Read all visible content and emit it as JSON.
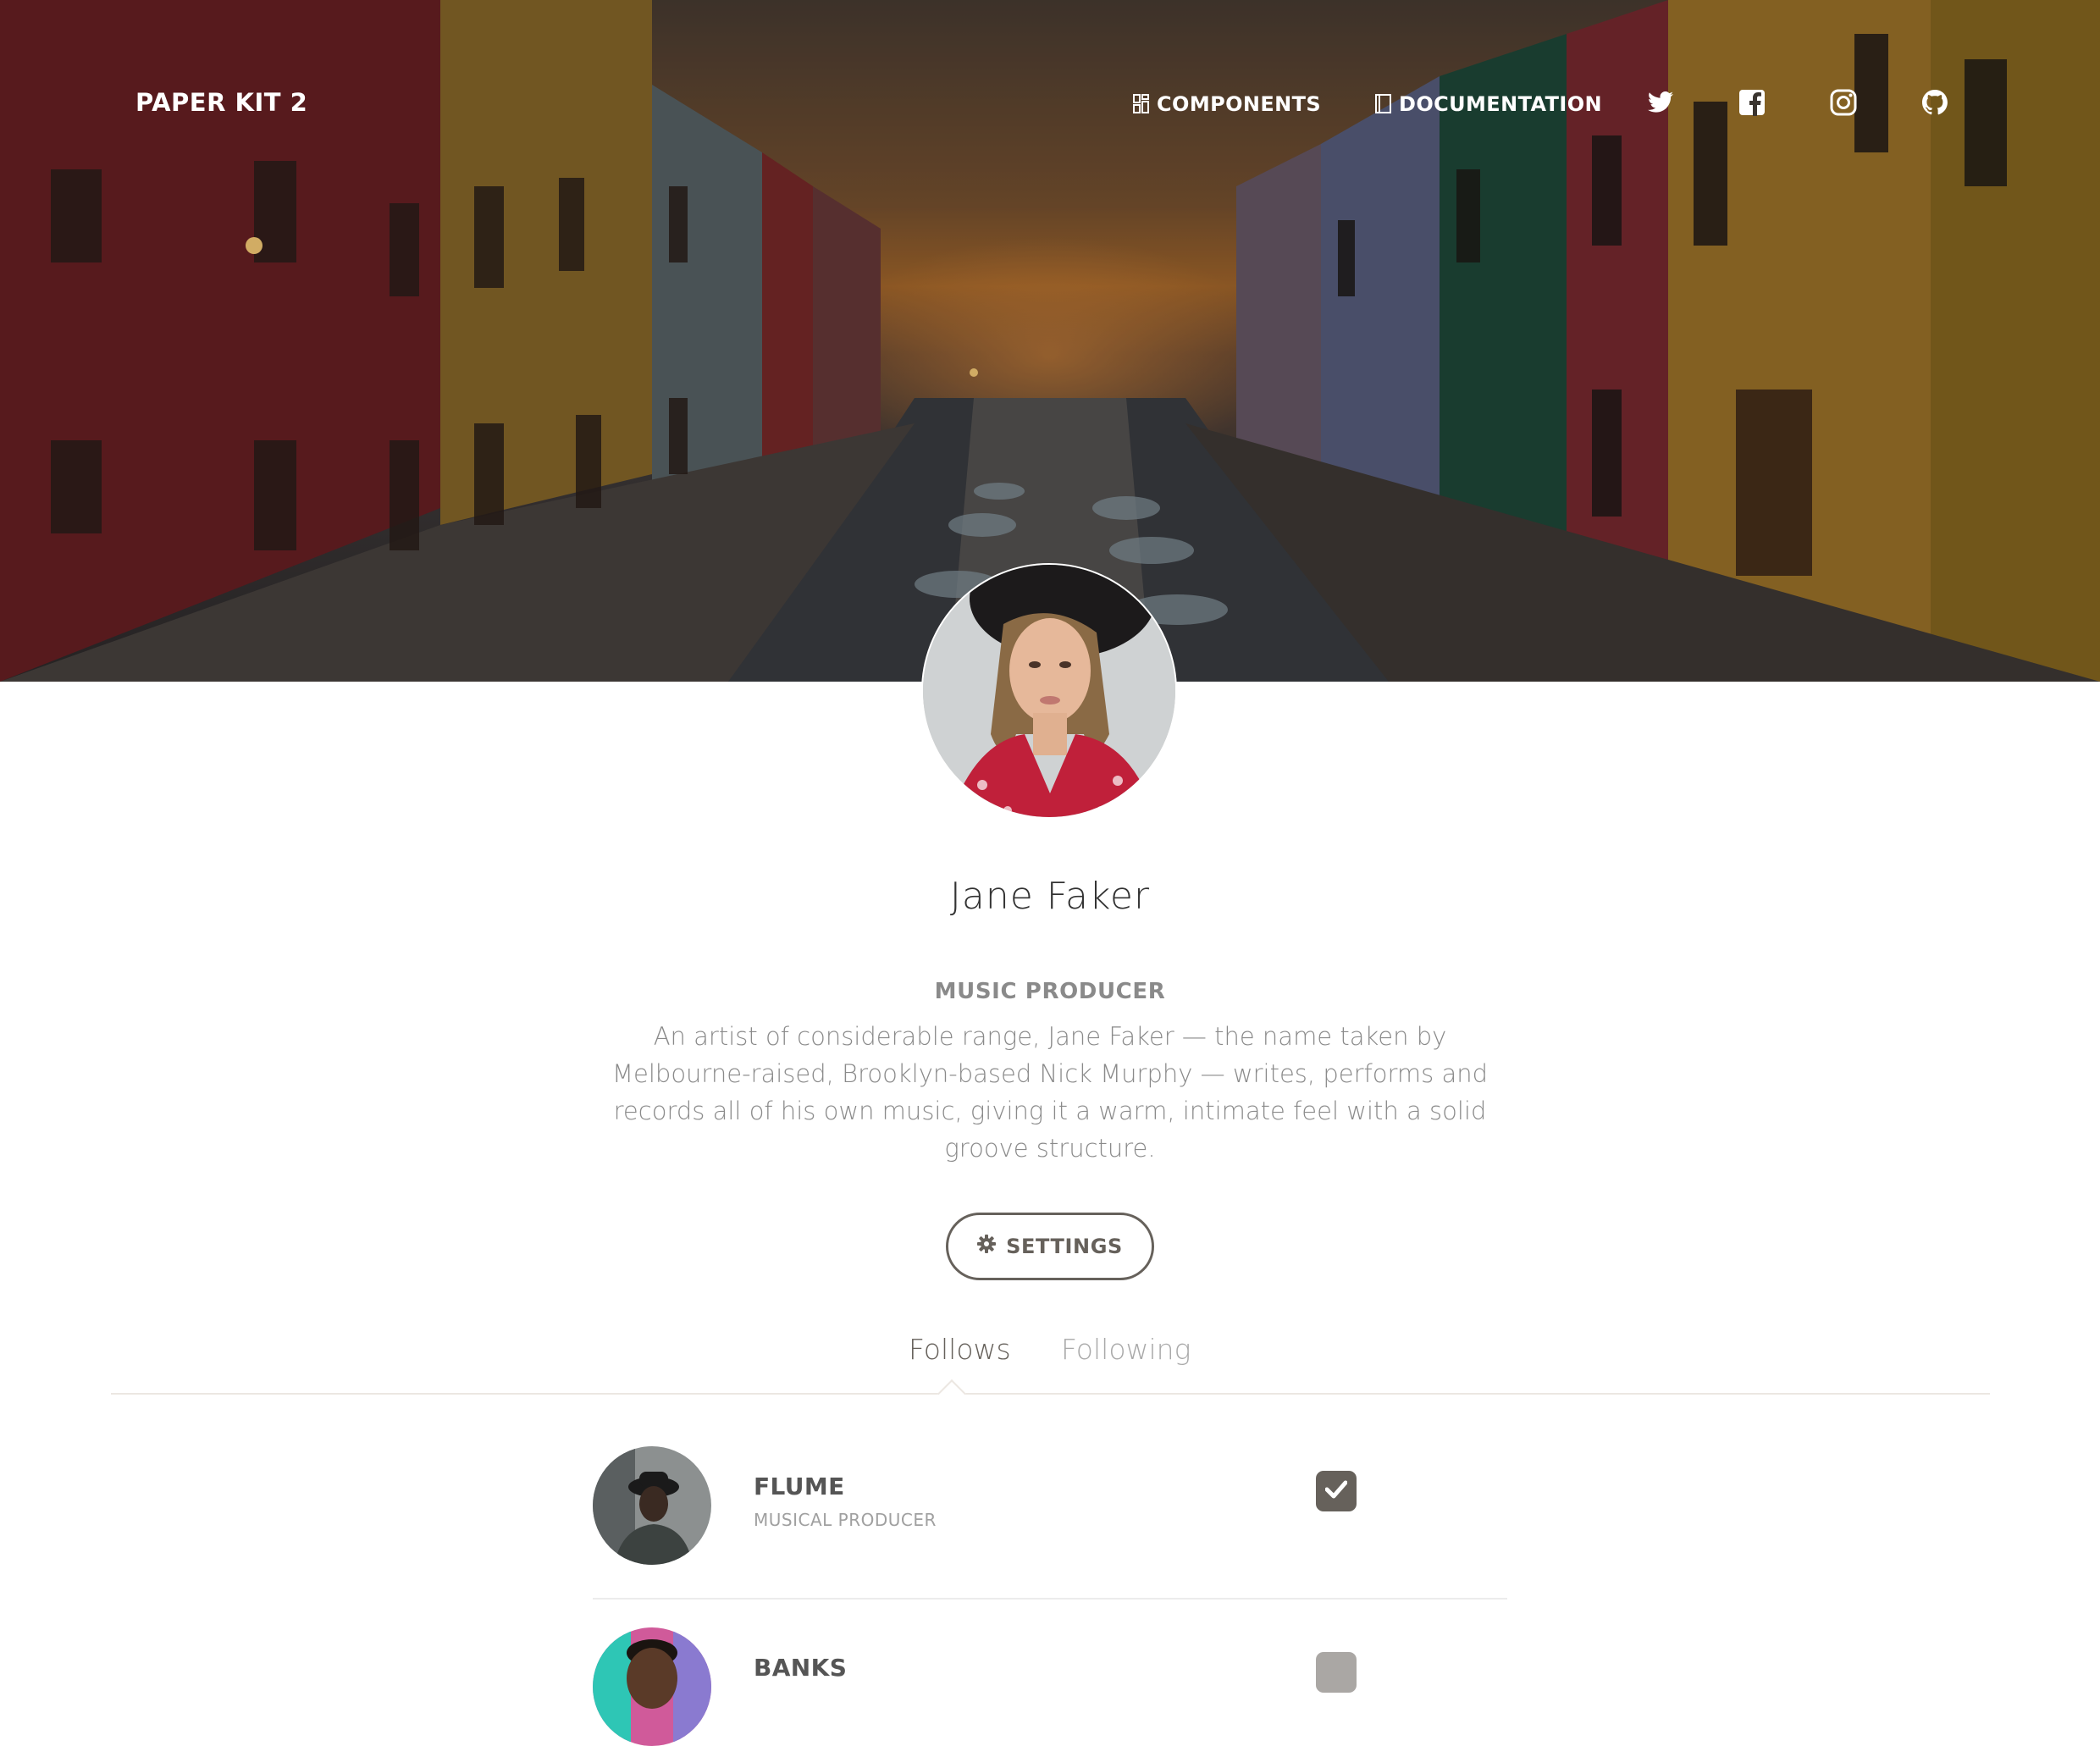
{
  "navbar": {
    "brand": "PAPER KIT 2",
    "links": [
      {
        "label": "COMPONENTS",
        "icon": "layout-icon"
      },
      {
        "label": "DOCUMENTATION",
        "icon": "book-icon"
      }
    ],
    "social": [
      "twitter-icon",
      "facebook-icon",
      "instagram-icon",
      "github-icon"
    ]
  },
  "profile": {
    "name": "Jane Faker",
    "title": "MUSIC PRODUCER",
    "bio": "An artist of considerable range, Jane Faker — the name taken by Melbourne-raised, Brooklyn-based Nick Murphy — writes, performs and records all of his own music, giving it a warm, intimate feel with a solid groove structure.",
    "settings_label": "SETTINGS"
  },
  "tabs": {
    "follows": "Follows",
    "following": "Following",
    "active": "Follows"
  },
  "follows": [
    {
      "name": "FLUME",
      "role": "MUSICAL PRODUCER",
      "checked": true
    },
    {
      "name": "BANKS",
      "role": "",
      "checked": false
    }
  ],
  "colors": {
    "text": "#66615b",
    "muted": "#8a8a8a",
    "checked_box": "#66615b",
    "unchecked_box": "#aaa7a4"
  }
}
